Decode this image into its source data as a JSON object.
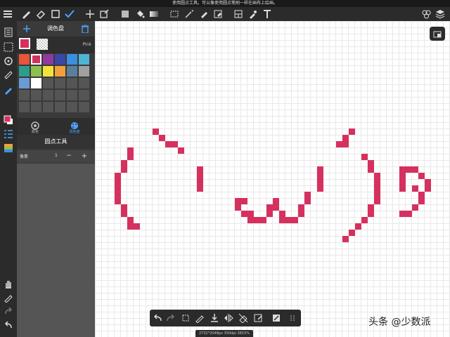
{
  "notice": "使用圆点工具。可以像使用圆点笔刷一样在画布上绘画。",
  "panel": {
    "title": "调色盘",
    "current_color_name": "Pink",
    "palette_colors": [
      "#e8553c",
      "#d6305f",
      "#8e3a9e",
      "#3a47a8",
      "#3b8fe0",
      "#4fb3d4",
      "#2e9c8c",
      "#8ec04f",
      "#f2e43a",
      "#f2a03a",
      "#5a7f9a",
      "#a0a0a0",
      "#6b9bd4",
      "#ffffff",
      "#555555",
      "#555555",
      "#555555",
      "#555555",
      "#555555",
      "#555555",
      "#555555",
      "#555555",
      "#555555",
      "#555555",
      "#555555",
      "#555555",
      "#555555",
      "#555555",
      "#555555",
      "#555555"
    ],
    "tab_color_label": "颜色",
    "tab_palette_label": "调色盘",
    "tool_title": "圆点工具",
    "pixel_label": "像素",
    "pixel_value": "1",
    "minus_label": "−",
    "plus_label": "+"
  },
  "status_text": "2732*2048px 350dpi 3815%",
  "watermark": "头条 @少数派",
  "accent_color": "#d6305f"
}
